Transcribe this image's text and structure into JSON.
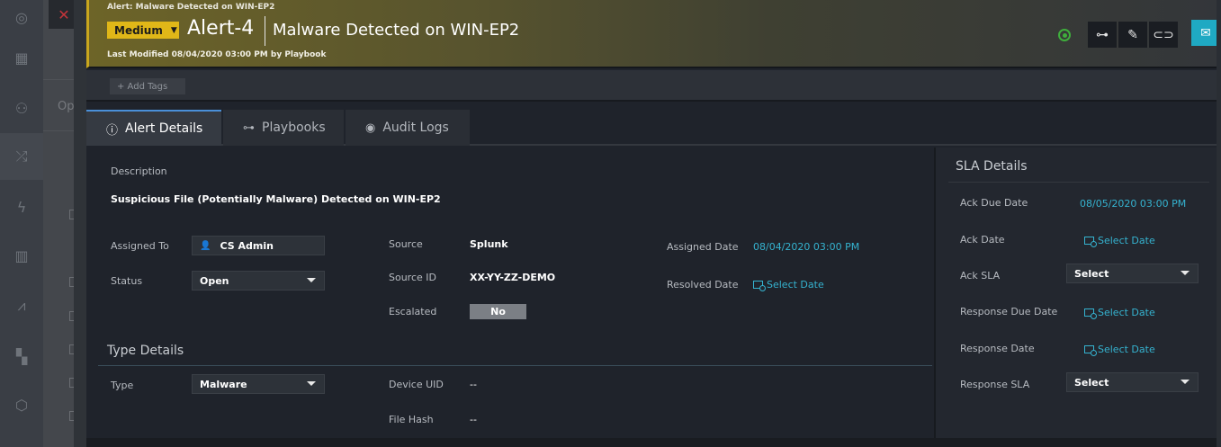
{
  "header": {
    "breadcrumb": "Alert: Malware Detected on WIN-EP2",
    "severity": "Medium",
    "alert_id": "Alert-4",
    "alert_name": "Malware Detected on WIN-EP2",
    "modified": "Last Modified 08/04/2020 03:00 PM by Playbook"
  },
  "tags": {
    "add_label": "+ Add Tags"
  },
  "tabs": [
    {
      "label": "Alert Details",
      "icon": "info-icon"
    },
    {
      "label": "Playbooks",
      "icon": "playbook-icon"
    },
    {
      "label": "Audit Logs",
      "icon": "eye-icon"
    }
  ],
  "details": {
    "description_label": "Description",
    "description": "Suspicious File (Potentially Malware) Detected on WIN-EP2",
    "assigned_to_label": "Assigned To",
    "assigned_to": "CS Admin",
    "status_label": "Status",
    "status": "Open",
    "source_label": "Source",
    "source": "Splunk",
    "source_id_label": "Source ID",
    "source_id": "XX-YY-ZZ-DEMO",
    "escalated_label": "Escalated",
    "escalated": "No",
    "assigned_date_label": "Assigned Date",
    "assigned_date": "08/04/2020 03:00 PM",
    "resolved_date_label": "Resolved Date",
    "resolved_date": "Select Date"
  },
  "type_details": {
    "title": "Type Details",
    "type_label": "Type",
    "type": "Malware",
    "device_uid_label": "Device UID",
    "device_uid": "--",
    "file_hash_label": "File Hash",
    "file_hash": "--"
  },
  "sla": {
    "title": "SLA Details",
    "ack_due_label": "Ack Due Date",
    "ack_due": "08/05/2020 03:00 PM",
    "ack_date_label": "Ack Date",
    "ack_date": "Select Date",
    "ack_sla_label": "Ack SLA",
    "ack_sla": "Select",
    "resp_due_label": "Response Due Date",
    "resp_due": "Select Date",
    "resp_date_label": "Response Date",
    "resp_date": "Select Date",
    "resp_sla_label": "Response SLA",
    "resp_sla": "Select"
  },
  "background": {
    "partial_label": "Op"
  },
  "colors": {
    "severity": "#e0b718",
    "link": "#35b3d0",
    "accent": "#1fa9c3"
  }
}
